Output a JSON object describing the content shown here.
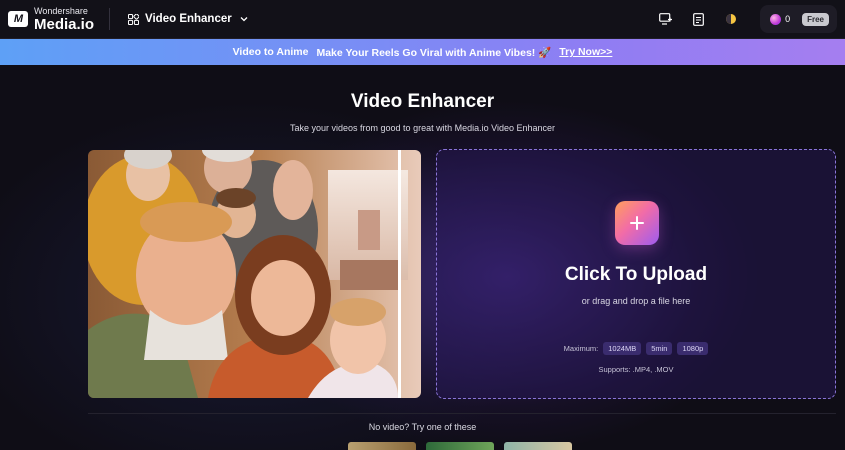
{
  "header": {
    "brand_small": "Wondershare",
    "brand_big": "Media.io",
    "logo_mark": "M",
    "tool_name": "Video Enhancer",
    "credits": "0",
    "plan_badge": "Free",
    "icons": [
      "grid-icon",
      "chevron-down-icon",
      "screen-add-icon",
      "document-icon",
      "theme-toggle-icon",
      "credit-gem-icon"
    ]
  },
  "promo": {
    "tag": "Video to Anime",
    "message": "Make Your Reels Go Viral with Anime Vibes! 🚀",
    "link": "Try Now>>"
  },
  "main": {
    "title": "Video Enhancer",
    "subtitle": "Take your videos from good to great with Media.io Video Enhancer"
  },
  "upload": {
    "title": "Click To Upload",
    "subtitle": "or drag and drop a file here",
    "maximum_label": "Maximum:",
    "limits": [
      "1024MB",
      "5min",
      "1080p"
    ],
    "supports": "Supports: .MP4, .MOV"
  },
  "samples": {
    "label": "No video? Try one of these"
  },
  "colors": {
    "accent": "#8a75d8",
    "promo_start": "#5ea0f6",
    "promo_end": "#a57ef0",
    "plus_gradient": [
      "#ff9f5c",
      "#f26ca7",
      "#9d5cf0"
    ]
  }
}
